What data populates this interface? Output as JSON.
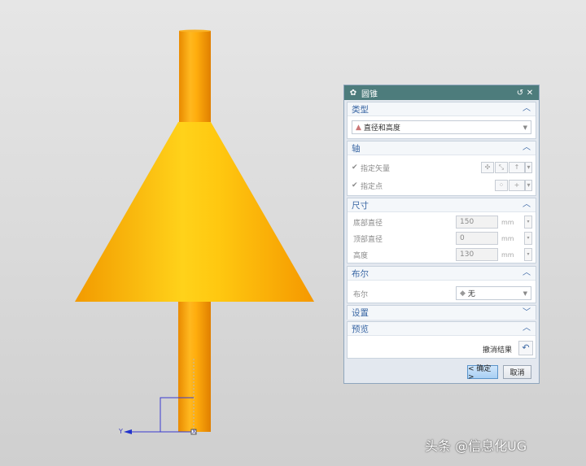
{
  "dialog": {
    "title": "圆锥",
    "sections": {
      "type": {
        "label": "类型",
        "select_value": "直径和高度"
      },
      "axis": {
        "label": "轴",
        "vector_label": "指定矢量",
        "point_label": "指定点"
      },
      "dimensions": {
        "label": "尺寸",
        "fields": [
          {
            "label": "底部直径",
            "value": "150",
            "unit": "mm"
          },
          {
            "label": "顶部直径",
            "value": "0",
            "unit": "mm"
          },
          {
            "label": "高度",
            "value": "130",
            "unit": "mm"
          }
        ]
      },
      "boolean": {
        "label": "布尔",
        "field_label": "布尔",
        "select_value": "无"
      },
      "settings": {
        "label": "设置"
      },
      "preview": {
        "label": "预览",
        "undo_label": "撤消结果"
      }
    },
    "ok_label": "< 确定 >",
    "cancel_label": "取消"
  },
  "viewport": {
    "triad_y_label": "Y",
    "triad_x_label": "X"
  },
  "watermark": "头条 @信息化UG",
  "colors": {
    "model_orange": "#f7a500",
    "title_bar": "#4d7c7c",
    "accent_blue": "#3a67a4"
  }
}
